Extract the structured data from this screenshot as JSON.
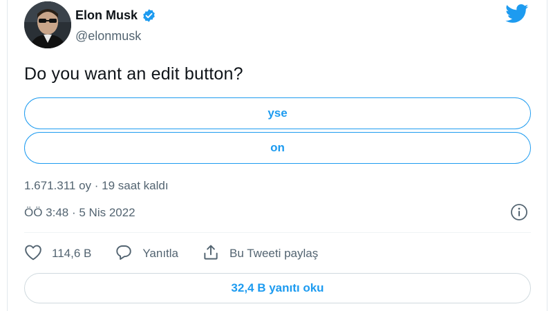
{
  "author": {
    "name": "Elon Musk",
    "handle": "@elonmusk",
    "verified": true,
    "avatar_icon": "profile-photo"
  },
  "tweet": {
    "text": "Do you want an edit button?"
  },
  "poll": {
    "options": [
      {
        "label": "yse"
      },
      {
        "label": "on"
      }
    ],
    "meta": "1.671.311 oy · 19 saat kaldı"
  },
  "timestamp": "ÖÖ 3:48 · 5 Nis 2022",
  "actions": {
    "like_count": "114,6 B",
    "reply_label": "Yanıtla",
    "share_label": "Bu Tweeti paylaş"
  },
  "read_replies_label": "32,4 B yanıtı oku",
  "icons": {
    "brand": "twitter-bird-icon",
    "verified": "verified-badge-icon",
    "info": "info-icon",
    "like": "heart-icon",
    "reply": "comment-icon",
    "share": "share-icon"
  },
  "colors": {
    "accent": "#1d9bf0",
    "text": "#0f1419",
    "muted": "#536471"
  }
}
